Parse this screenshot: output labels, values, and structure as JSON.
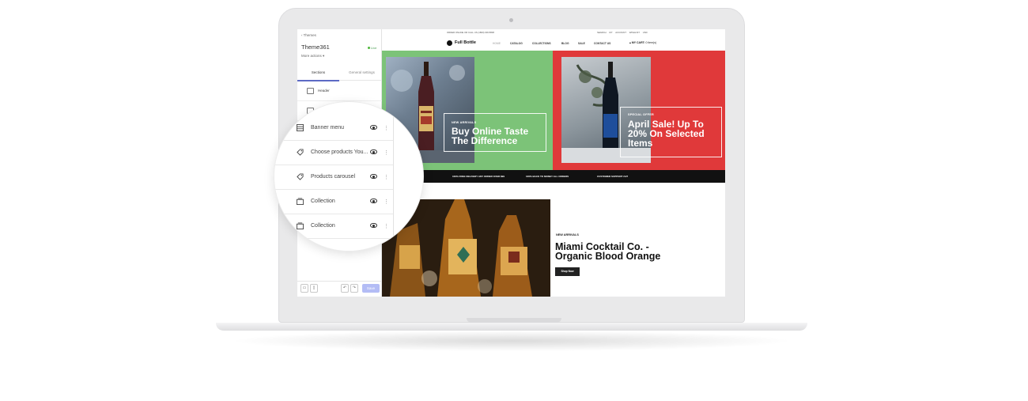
{
  "sidebar": {
    "back_label": "Themes",
    "theme_name": "Theme361",
    "live_label": "Live",
    "more_actions": "More actions",
    "tabs": [
      "Sections",
      "General settings"
    ],
    "items": [
      {
        "label": "Header"
      }
    ]
  },
  "magnifier": {
    "items": [
      {
        "label": "Banner menu",
        "icon": "layout-icon"
      },
      {
        "label": "Choose products You...",
        "icon": "tag-icon"
      },
      {
        "label": "Products carousel",
        "icon": "tag-icon"
      },
      {
        "label": "Collection",
        "icon": "collection-icon"
      },
      {
        "label": "Collection",
        "icon": "collection-icon"
      }
    ]
  },
  "footer": {
    "save_label": "Save"
  },
  "store": {
    "announcement": "ORDER ONLINE OR CALL US (1800) 000 8808",
    "tools": "SEARCH   MY ACCOUNT   WISHLIST   USD",
    "logo": "Full Bottle",
    "nav": [
      "HOME",
      "CATALOG",
      "COLLECTIONS",
      "BLOG",
      "SALE",
      "CONTACT US"
    ],
    "cart_label": "MY CART:",
    "cart_value": "0 item(s)",
    "banner_left": {
      "eyebrow": "NEW ARRIVALS",
      "headline": "Buy Online Taste The Difference"
    },
    "banner_right": {
      "eyebrow": "SPECIAL OFFER",
      "headline": "April Sale! Up To 20% On Selected Items"
    },
    "strip": [
      "100% FREE DELIVERY ANY ORDER OVER $99",
      "100% BACK TO MONEY ALL ORDERS",
      "CUSTOMER SUPPORT 24/7"
    ],
    "feature": {
      "eyebrow": "NEW ARRIVALS",
      "title": "Miami Cocktail Co. - Organic Blood Orange",
      "button": "Shop Now"
    }
  },
  "colors": {
    "green_banner": "#7cc378",
    "red_banner": "#e0393a",
    "save_button": "#b3bcf5",
    "tab_accent": "#5c6ac4"
  }
}
